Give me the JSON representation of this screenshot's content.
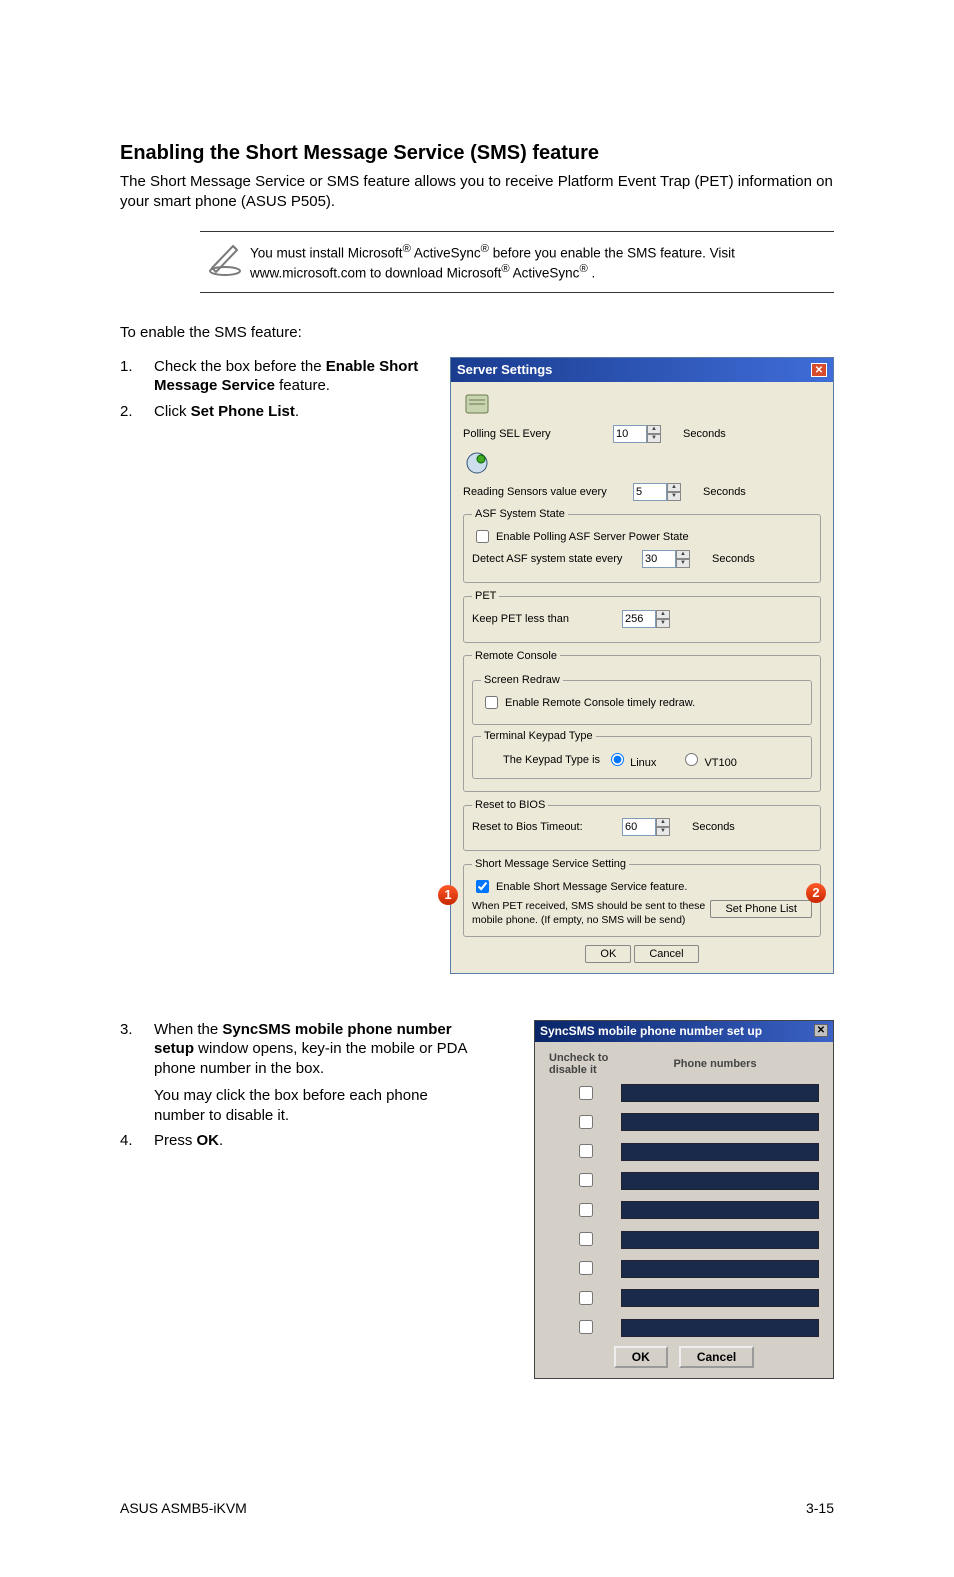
{
  "heading": "Enabling the Short Message Service (SMS) feature",
  "intro": "The Short Message Service or SMS feature allows you to receive Platform Event Trap (PET) information on your smart phone (ASUS P505).",
  "note": {
    "line1_a": "You must install Microsoft",
    "line1_b": " ActiveSync",
    "line1_c": " before you enable the SMS feature. Visit www.microsoft.com to download Microsoft",
    "line1_d": " ActiveSync",
    "line1_e": " ."
  },
  "enable_line": "To enable the SMS feature:",
  "steps_a": [
    {
      "n": "1.",
      "pre": "Check the box before the ",
      "bold": "Enable Short Message Service",
      "post": " feature."
    },
    {
      "n": "2.",
      "pre": "Click ",
      "bold": "Set Phone List",
      "post": "."
    }
  ],
  "steps_b": {
    "s3": {
      "n": "3.",
      "pre": "When the ",
      "bold": "SyncSMS mobile phone number setup",
      "post": " window opens, key-in the mobile or PDA phone number in the box."
    },
    "s3_sub": "You may click the box before each phone number to disable it.",
    "s4": {
      "n": "4.",
      "pre": " Press ",
      "bold": "OK",
      "post": "."
    }
  },
  "server": {
    "title": "Server Settings",
    "polling_label": "Polling SEL Every",
    "polling_val": "10",
    "seconds": "Seconds",
    "reading_label": "Reading Sensors value every",
    "reading_val": "5",
    "asf_legend": "ASF System State",
    "asf_cb": "Enable Polling ASF Server Power State",
    "asf_detect": "Detect ASF system state every",
    "asf_val": "30",
    "pet_legend": "PET",
    "pet_label": "Keep PET less than",
    "pet_val": "256",
    "rc_legend": "Remote Console",
    "sr_legend": "Screen Redraw",
    "sr_cb": "Enable Remote Console timely redraw.",
    "tk_legend": "Terminal Keypad Type",
    "tk_label": "The Keypad Type is",
    "tk_linux": "Linux",
    "tk_vt100": "VT100",
    "rb_legend": "Reset to BIOS",
    "rb_label": "Reset to Bios Timeout:",
    "rb_val": "60",
    "sms_legend": "Short Message Service Setting",
    "sms_cb": "Enable Short Message Service feature.",
    "sms_note": "When PET received, SMS should be sent to these mobile phone. (If empty, no SMS will be send)",
    "set_phone": "Set Phone List",
    "ok": "OK",
    "cancel": "Cancel",
    "callout1": "1",
    "callout2": "2"
  },
  "sync": {
    "title": "SyncSMS mobile phone number set up",
    "col1a": "Uncheck to",
    "col1b": "disable it",
    "col2": "Phone numbers",
    "ok": "OK",
    "cancel": "Cancel"
  },
  "footer_left": "ASUS ASMB5-iKVM",
  "footer_right": "3-15"
}
